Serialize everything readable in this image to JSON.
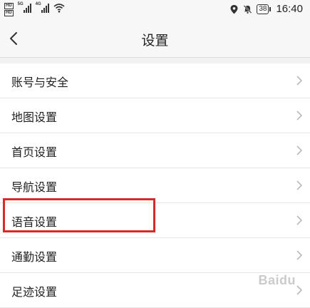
{
  "status_bar": {
    "left_badges": [
      "HD",
      "HD"
    ],
    "network": [
      "5G",
      "4G"
    ],
    "battery": "38",
    "time": "16:40",
    "icons": [
      "location-icon",
      "mute-icon",
      "wifi-icon",
      "signal-icon",
      "battery-icon"
    ]
  },
  "header": {
    "title": "设置"
  },
  "settings": {
    "items": [
      {
        "label": "账号与安全"
      },
      {
        "label": "地图设置"
      },
      {
        "label": "首页设置"
      },
      {
        "label": "导航设置"
      },
      {
        "label": "语音设置"
      },
      {
        "label": "通勤设置"
      },
      {
        "label": "足迹设置"
      }
    ]
  },
  "highlight": {
    "item": "语音设置",
    "color": "#d92a2a"
  },
  "watermark": "Baidu"
}
